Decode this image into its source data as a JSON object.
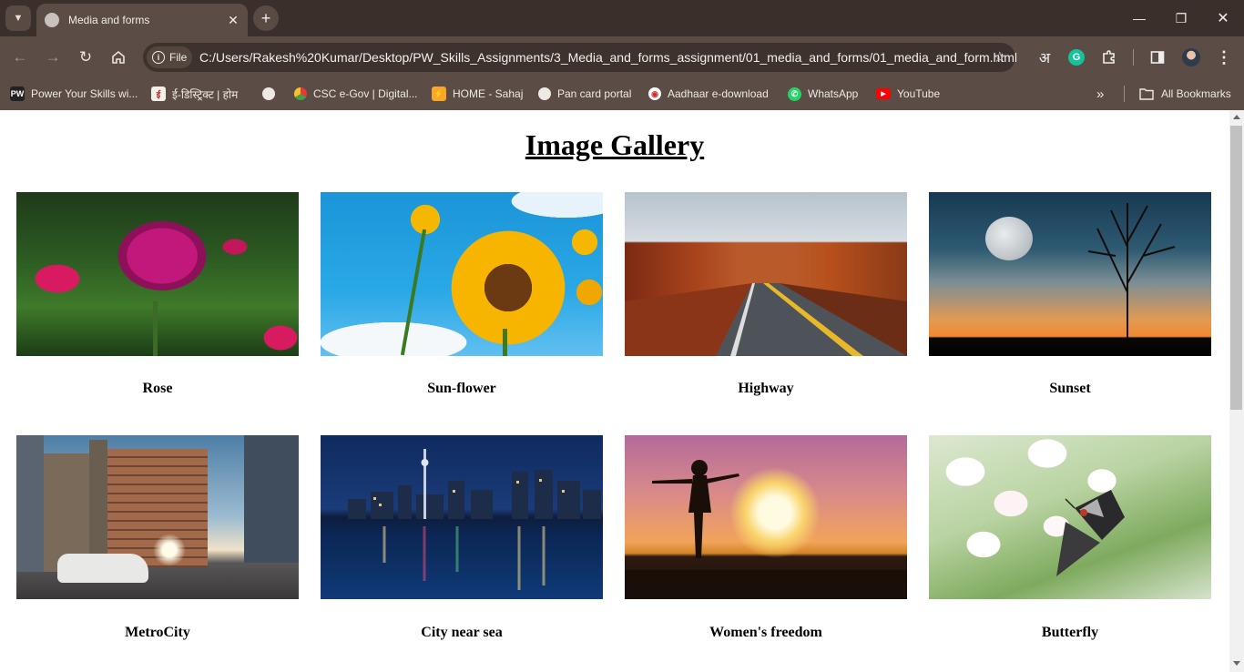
{
  "browser": {
    "tab_title": "Media and forms",
    "site_chip": "File",
    "url": "C:/Users/Rakesh%20Kumar/Desktop/PW_Skills_Assignments/3_Media_and_forms_assignment/01_media_and_forms/01_media_and_form.html",
    "translate_icon_text": "अ",
    "bookmarks": [
      {
        "label": "Power Your Skills wi...",
        "icon": "pw-icon"
      },
      {
        "label": "ई-डिस्ट्रिक्ट | होम",
        "icon": "edistrict-icon"
      },
      {
        "label": "",
        "icon": "globe-icon"
      },
      {
        "label": "CSC e-Gov | Digital...",
        "icon": "csc-icon"
      },
      {
        "label": "HOME - Sahaj",
        "icon": "sahaj-icon"
      },
      {
        "label": "Pan card portal",
        "icon": "globe-icon"
      },
      {
        "label": "Aadhaar e-download",
        "icon": "aadhaar-icon"
      },
      {
        "label": "WhatsApp",
        "icon": "whatsapp-icon"
      },
      {
        "label": "YouTube",
        "icon": "youtube-icon"
      }
    ],
    "all_bookmarks": "All Bookmarks"
  },
  "page": {
    "title": "Image Gallery",
    "gallery": [
      {
        "caption": "Rose",
        "image": "rose-photo"
      },
      {
        "caption": "Sun-flower",
        "image": "sunflower-photo"
      },
      {
        "caption": "Highway",
        "image": "highway-photo"
      },
      {
        "caption": "Sunset",
        "image": "sunset-photo"
      },
      {
        "caption": "MetroCity",
        "image": "metrocity-photo"
      },
      {
        "caption": "City near sea",
        "image": "city-near-sea-photo"
      },
      {
        "caption": "Women's freedom",
        "image": "womens-freedom-photo"
      },
      {
        "caption": "Butterfly",
        "image": "butterfly-photo"
      }
    ]
  },
  "colors": {
    "chrome_dark": "#3b2f2b",
    "chrome_toolbar": "#5b4c45",
    "omnibox": "#3e322e"
  }
}
